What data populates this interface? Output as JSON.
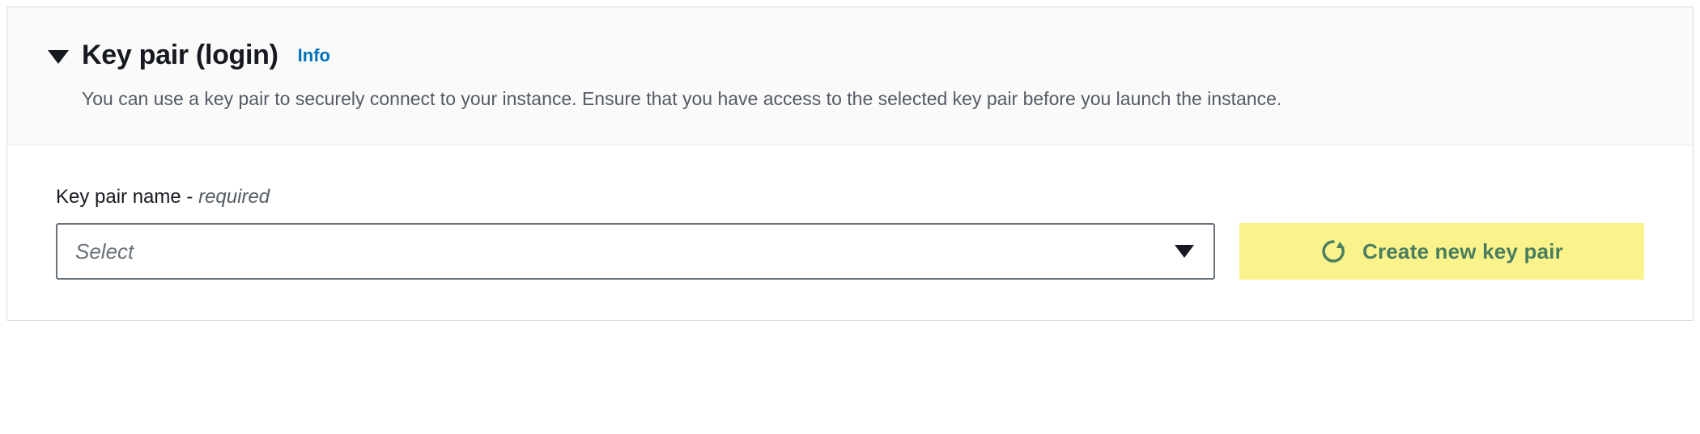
{
  "header": {
    "title": "Key pair (login)",
    "info_label": "Info",
    "description": "You can use a key pair to securely connect to your instance. Ensure that you have access to the selected key pair before you launch the instance."
  },
  "field": {
    "label": "Key pair name",
    "required_text": "required",
    "select_placeholder": "Select"
  },
  "create_button": {
    "label": "Create new key pair"
  },
  "icons": {
    "collapse": "caret-down",
    "dropdown": "caret-down",
    "refresh": "refresh"
  },
  "colors": {
    "info_link": "#0073bb",
    "highlight_yellow": "#faf38b",
    "button_text_green": "#4a7d5f",
    "border_gray": "#687078",
    "text_dark": "#16191f",
    "text_muted": "#545b64"
  }
}
